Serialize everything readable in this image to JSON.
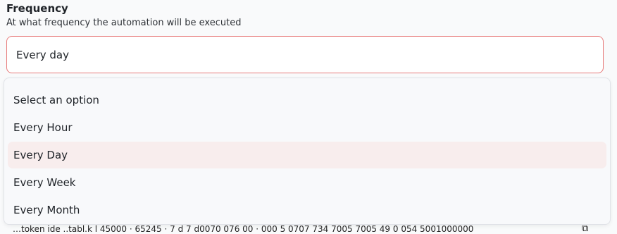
{
  "field": {
    "label": "Frequency",
    "help": "At what frequency the automation will be executed",
    "value": "Every day"
  },
  "dropdown": {
    "options": [
      "Select an option",
      "Every Hour",
      "Every Day",
      "Every Week",
      "Every Month"
    ],
    "highlighted_index": 2
  },
  "background": {
    "partial_text": "…token  ide  ..tabl.k  l 45000 · 65245 · 7  d 7 d0070  076 00 · 000  5     0707  734  7005  7005  49  0  054  5001000000",
    "icon": "copy-icon"
  },
  "colors": {
    "input_border": "#e77a7a",
    "highlight_bg": "#f8eded",
    "page_bg": "#f9fafb"
  }
}
